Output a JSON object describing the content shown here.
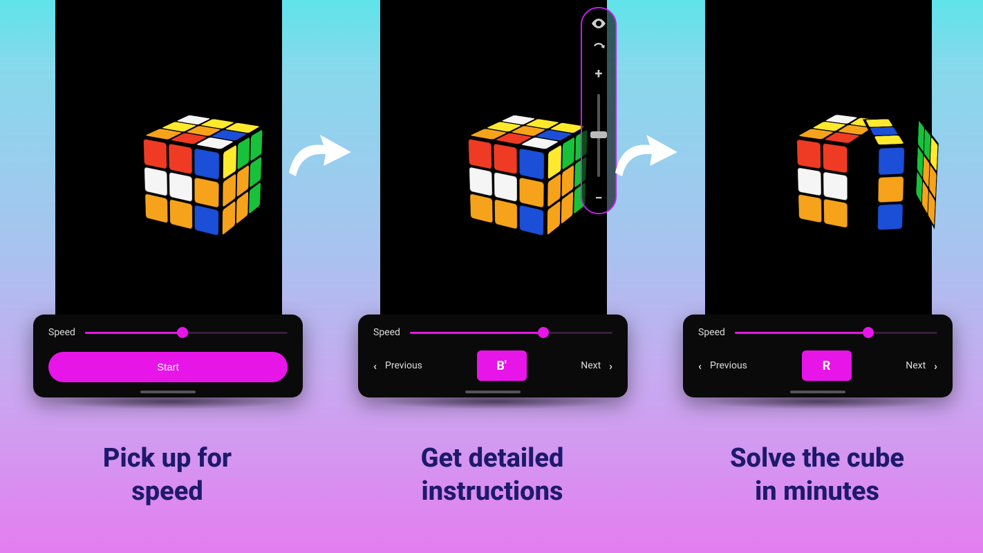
{
  "accent": "#e815e8",
  "panels": [
    {
      "caption_line1": "Pick up for",
      "caption_line2": "speed",
      "speed_label": "Speed",
      "speed_pct": 48,
      "start_label": "Start"
    },
    {
      "caption_line1": "Get detailed",
      "caption_line2": "instructions",
      "speed_label": "Speed",
      "speed_pct": 66,
      "prev_label": "Previous",
      "next_label": "Next",
      "move": "B'",
      "toolbar": {
        "eye": "eye-icon",
        "rotate": "rotate-3d-icon",
        "plus": "+",
        "minus": "−"
      }
    },
    {
      "caption_line1": "Solve the cube",
      "caption_line2": "in minutes",
      "speed_label": "Speed",
      "speed_pct": 66,
      "prev_label": "Previous",
      "next_label": "Next",
      "move": "R"
    }
  ],
  "cube": {
    "front": [
      "r",
      "r",
      "b",
      "w",
      "w",
      "o",
      "o",
      "o",
      "b"
    ],
    "right": [
      "y",
      "g",
      "g",
      "o",
      "o",
      "g",
      "o",
      "o",
      "g"
    ],
    "top": [
      "w",
      "y",
      "y",
      "y",
      "o",
      "b",
      "o",
      "r",
      "w"
    ]
  },
  "cube3": {
    "front2": [
      "r",
      "r",
      "w",
      "w",
      "o",
      "o"
    ],
    "top2": [
      "w",
      "y",
      "y",
      "o",
      "o",
      "r"
    ],
    "slice_front": [
      "b",
      "o",
      "b"
    ],
    "slice_top": [
      "y",
      "b",
      "y"
    ],
    "slice_right": [
      "y",
      "g",
      "g",
      "o",
      "o",
      "g",
      "o",
      "o",
      "g"
    ]
  }
}
